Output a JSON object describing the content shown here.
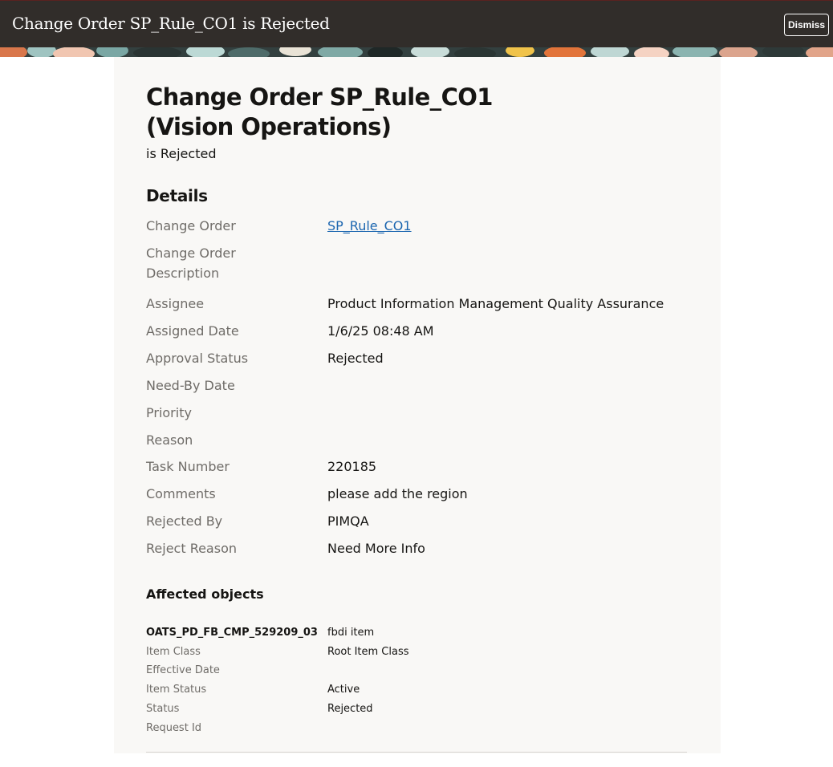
{
  "header": {
    "title": "Change Order SP_Rule_CO1 is Rejected",
    "dismiss_label": "Dismiss"
  },
  "colors": {
    "header_bg": "#312d2a",
    "card_bg": "#f9f8f6",
    "link": "#1c66b0",
    "label": "#6f6c68"
  },
  "main": {
    "title_line1": "Change Order SP_Rule_CO1",
    "title_line2": "(Vision Operations)",
    "subtitle": "is Rejected",
    "details_title": "Details",
    "details": [
      {
        "label": "Change Order",
        "value": "SP_Rule_CO1"
      },
      {
        "label": "Change Order Description",
        "value": ""
      },
      {
        "label": "Assignee",
        "value": "Product Information Management Quality Assurance"
      },
      {
        "label": "Assigned Date",
        "value": "1/6/25 08:48 AM"
      },
      {
        "label": "Approval Status",
        "value": "Rejected"
      },
      {
        "label": "Need-By Date",
        "value": ""
      },
      {
        "label": "Priority",
        "value": ""
      },
      {
        "label": "Reason",
        "value": ""
      },
      {
        "label": "Task Number",
        "value": "220185"
      },
      {
        "label": "Comments",
        "value": "please add the region"
      },
      {
        "label": "Rejected By",
        "value": "PIMQA"
      },
      {
        "label": "Reject Reason",
        "value": "Need More Info"
      }
    ],
    "affected_title": "Affected objects",
    "affected_objects": [
      {
        "item_name": "OATS_PD_FB_CMP_529209_03",
        "item_description": "fbdi item",
        "fields": [
          {
            "label": "Item Class",
            "value": "Root Item Class"
          },
          {
            "label": "Effective Date",
            "value": ""
          },
          {
            "label": "Item Status",
            "value": "Active"
          },
          {
            "label": "Status",
            "value": "Rejected"
          },
          {
            "label": "Request Id",
            "value": ""
          }
        ]
      }
    ]
  }
}
